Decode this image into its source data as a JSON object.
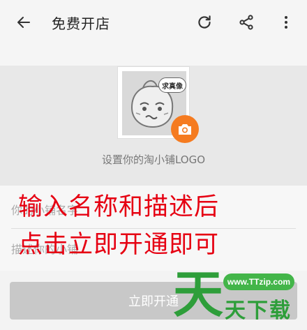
{
  "appbar": {
    "title": "免费开店",
    "icons": {
      "back": "arrow-left-icon",
      "refresh": "refresh-icon",
      "share": "share-icon",
      "more": "more-vertical-icon"
    }
  },
  "logo": {
    "bubble_text": "求真像",
    "caption": "设置你的淘小铺LOGO",
    "badge_icon": "camera-icon",
    "badge_color": "#f57b20"
  },
  "form": {
    "name_placeholder": "你的小铺名字",
    "desc_placeholder": "描述你的小铺"
  },
  "overlay": {
    "line1": "输入名称和描述后",
    "line2": "点击立即开通即可",
    "color": "#e60012"
  },
  "submit": {
    "label": "立即开通"
  },
  "watermark": {
    "url": "www.TTzip.com",
    "char": "天",
    "text": "天下载"
  }
}
